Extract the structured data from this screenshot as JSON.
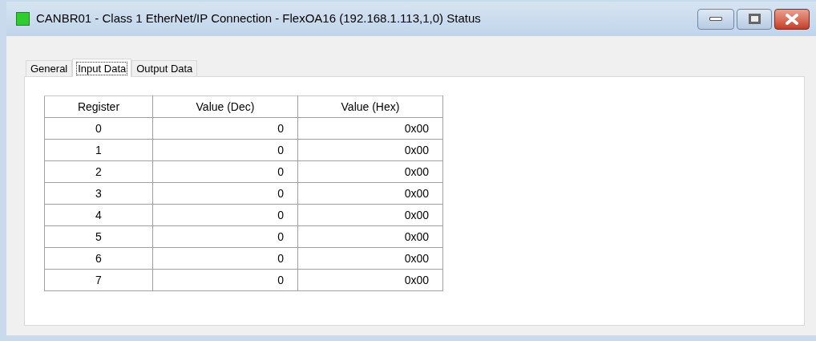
{
  "window": {
    "title": "CANBR01 - Class 1 EtherNet/IP Connection - FlexOA16 (192.168.1.113,1,0) Status"
  },
  "tabs": [
    {
      "label": "General",
      "selected": false
    },
    {
      "label": "Input Data",
      "selected": true
    },
    {
      "label": "Output Data",
      "selected": false
    }
  ],
  "table": {
    "columns": [
      "Register",
      "Value (Dec)",
      "Value (Hex)"
    ],
    "rows": [
      [
        "0",
        "0",
        "0x00"
      ],
      [
        "1",
        "0",
        "0x00"
      ],
      [
        "2",
        "0",
        "0x00"
      ],
      [
        "3",
        "0",
        "0x00"
      ],
      [
        "4",
        "0",
        "0x00"
      ],
      [
        "5",
        "0",
        "0x00"
      ],
      [
        "6",
        "0",
        "0x00"
      ],
      [
        "7",
        "0",
        "0x00"
      ]
    ]
  }
}
